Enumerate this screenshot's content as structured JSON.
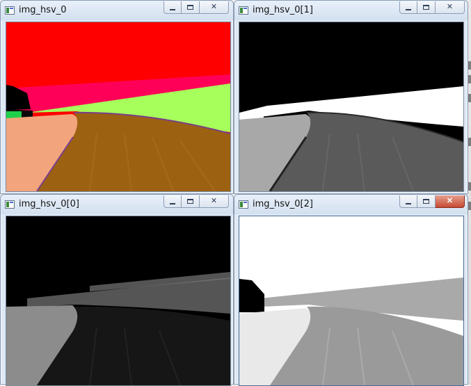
{
  "windows": [
    {
      "title": "img_hsv_0",
      "active": false,
      "icon": "opencv-window-icon"
    },
    {
      "title": "img_hsv_0[1]",
      "active": false,
      "icon": "opencv-window-icon"
    },
    {
      "title": "img_hsv_0[0]",
      "active": false,
      "icon": "opencv-window-icon"
    },
    {
      "title": "img_hsv_0[2]",
      "active": true,
      "icon": "opencv-window-icon"
    }
  ],
  "controls": {
    "minimize": "minimize-icon",
    "maximize": "maximize-icon",
    "close": "close-icon",
    "close_glyph": "✕"
  },
  "colors": {
    "hsv_sky": "#ff0000",
    "hsv_horizon": "#a6ff5a",
    "hsv_sidewalk": "#f2a57c",
    "hsv_road": "#9c6212",
    "active_close": "#c64a32"
  }
}
